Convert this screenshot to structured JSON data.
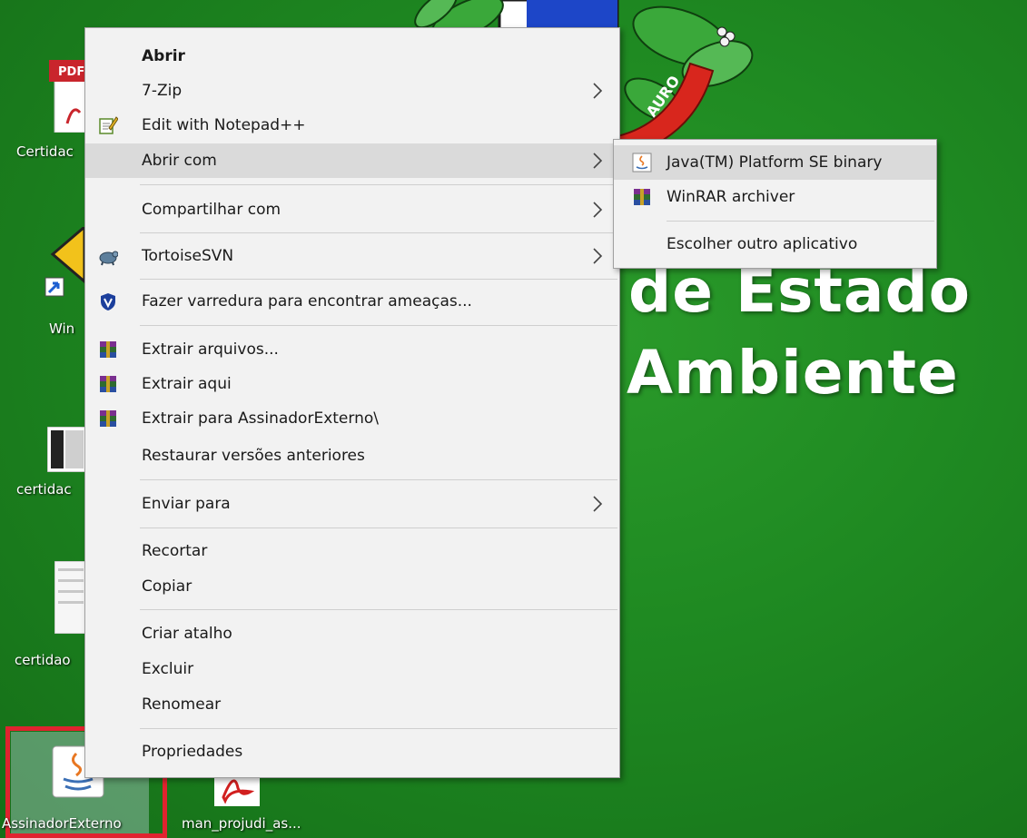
{
  "wallpaper": {
    "line1": "de Estado",
    "line2": "Ambiente",
    "emblem_ribbon": "AURO"
  },
  "desktop_icons": [
    {
      "label": "Certidac",
      "icon": "pdf-file-icon"
    },
    {
      "label": "Win",
      "icon": "shortcut-icon"
    },
    {
      "label": "certidac",
      "icon": "image-file-icon"
    },
    {
      "label": "certidao",
      "icon": "document-file-icon"
    },
    {
      "label": "AssinadorExterno",
      "icon": "java-jar-icon"
    },
    {
      "label": "man_projudi_as...",
      "icon": "pdf-file-icon"
    }
  ],
  "pdf_badge": "PDF",
  "context_menu": {
    "items": [
      {
        "label": "Abrir",
        "bold": true
      },
      {
        "label": "7-Zip",
        "submenu": true
      },
      {
        "label": "Edit with Notepad++",
        "icon": "notepad-plus-plus-icon"
      },
      {
        "label": "Abrir com",
        "submenu": true,
        "highlighted": true
      },
      {
        "label": "Compartilhar com",
        "submenu": true
      },
      {
        "label": "TortoiseSVN",
        "submenu": true,
        "icon": "tortoisesvn-icon"
      },
      {
        "label": "Fazer varredura para encontrar ameaças...",
        "icon": "defender-shield-icon"
      },
      {
        "label": "Extrair arquivos...",
        "icon": "winrar-icon"
      },
      {
        "label": "Extrair aqui",
        "icon": "winrar-icon"
      },
      {
        "label": "Extrair para AssinadorExterno\\",
        "icon": "winrar-icon"
      },
      {
        "label": "Restaurar versões anteriores"
      },
      {
        "label": "Enviar para",
        "submenu": true
      },
      {
        "label": "Recortar"
      },
      {
        "label": "Copiar"
      },
      {
        "label": "Criar atalho"
      },
      {
        "label": "Excluir"
      },
      {
        "label": "Renomear"
      },
      {
        "label": "Propriedades"
      }
    ]
  },
  "submenu_abrir_com": {
    "items": [
      {
        "label": "Java(TM) Platform SE binary",
        "icon": "java-icon",
        "highlighted": true
      },
      {
        "label": "WinRAR archiver",
        "icon": "winrar-icon"
      },
      {
        "label": "Escolher outro aplicativo"
      }
    ]
  },
  "colors": {
    "desktop_green": "#1f8a22",
    "menu_bg": "#f2f2f2",
    "highlight": "#dadada",
    "selection_frame": "#e0232f"
  }
}
